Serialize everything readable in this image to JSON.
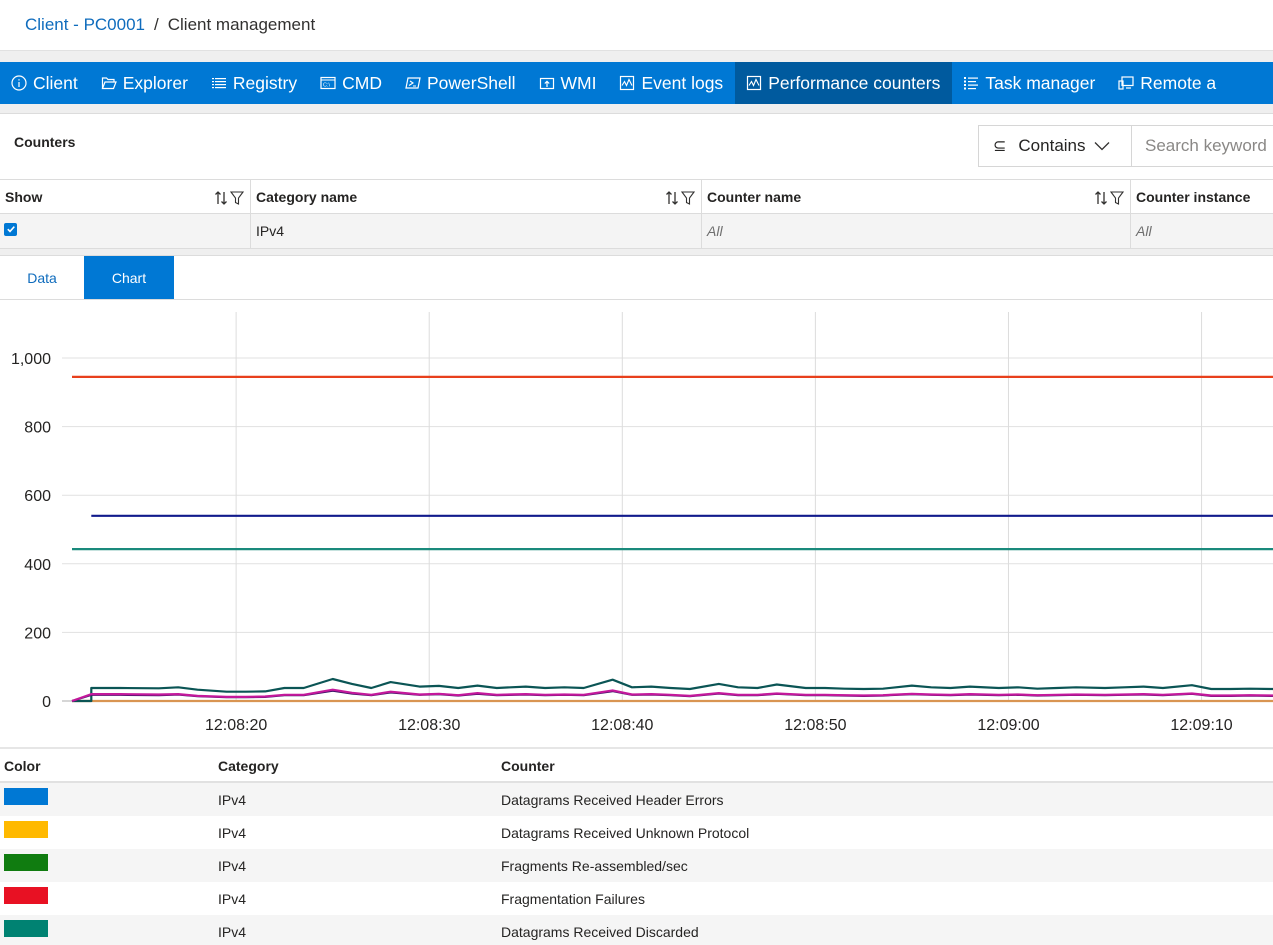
{
  "breadcrumb": {
    "link": "Client - PC0001",
    "separator": "/",
    "current": "Client management"
  },
  "toolbar": {
    "items": [
      {
        "label": "Client",
        "icon": "info-icon",
        "active": false
      },
      {
        "label": "Explorer",
        "icon": "folder-open-icon",
        "active": false
      },
      {
        "label": "Registry",
        "icon": "list-icon",
        "active": false
      },
      {
        "label": "CMD",
        "icon": "terminal-icon",
        "active": false
      },
      {
        "label": "PowerShell",
        "icon": "powershell-icon",
        "active": false
      },
      {
        "label": "WMI",
        "icon": "upload-box-icon",
        "active": false
      },
      {
        "label": "Event logs",
        "icon": "chart-box-icon",
        "active": false
      },
      {
        "label": "Performance counters",
        "icon": "chart-box-icon",
        "active": true
      },
      {
        "label": "Task manager",
        "icon": "task-list-icon",
        "active": false
      },
      {
        "label": "Remote a",
        "icon": "remote-desktop-icon",
        "active": false
      }
    ],
    "colors": {
      "bar": "#0078d4",
      "active": "#005a9e"
    }
  },
  "counters": {
    "title": "Counters",
    "filter_mode": "Contains",
    "search_placeholder": "Search keyword",
    "columns": [
      "Show",
      "Category name",
      "Counter name",
      "Counter instance"
    ],
    "rows": [
      {
        "show": true,
        "category": "IPv4",
        "counter": "All",
        "instance": "All"
      }
    ]
  },
  "view_tabs": {
    "items": [
      "Data",
      "Chart"
    ],
    "active": "Chart"
  },
  "chart_data": {
    "type": "line",
    "title": "",
    "xlabel": "",
    "ylabel": "",
    "ylim": [
      0,
      1100
    ],
    "yticks": [
      0,
      200,
      400,
      600,
      800,
      1000
    ],
    "ytick_labels": [
      "0",
      "200",
      "400",
      "600",
      "800",
      "1,000"
    ],
    "xlim_seconds": [
      11.5,
      73.7
    ],
    "xticks_seconds": [
      20,
      30,
      40,
      50,
      60,
      70
    ],
    "xtick_labels": [
      "12:08:20",
      "12:08:30",
      "12:08:40",
      "12:08:50",
      "12:09:00",
      "12:09:10"
    ],
    "x_base_time": "12:08:00",
    "grid": true,
    "series": [
      {
        "name": "Series (red)",
        "color": "#e8401c",
        "x": [
          11.5,
          73.7
        ],
        "values": [
          945,
          945
        ]
      },
      {
        "name": "Series (navy)",
        "color": "#111a8c",
        "x": [
          12.5,
          73.7
        ],
        "values": [
          540,
          540
        ]
      },
      {
        "name": "Series (teal)",
        "color": "#1a8a7c",
        "x": [
          11.5,
          73.7
        ],
        "values": [
          443,
          443
        ]
      },
      {
        "name": "Series (orange)",
        "color": "#d99552",
        "x": [
          11.5,
          73.7
        ],
        "values": [
          0,
          0
        ]
      },
      {
        "name": "Series (dark teal)",
        "color": "#0b5555",
        "x": [
          11.5,
          12.5,
          12.5,
          14,
          16,
          17,
          18,
          19.5,
          20.5,
          21.5,
          22.5,
          23.5,
          25,
          26,
          27,
          28,
          29.5,
          30.5,
          31.5,
          32.5,
          33.5,
          35,
          36,
          37,
          38,
          39.5,
          40.5,
          41.5,
          42.5,
          43.5,
          45,
          46,
          47,
          48,
          49.5,
          50.5,
          51.5,
          52.5,
          53.5,
          55,
          56,
          57,
          58,
          59.5,
          60.5,
          61.5,
          62.5,
          63.5,
          65,
          66,
          67,
          68,
          69.5,
          70.5,
          71.5,
          72.5,
          73.7
        ],
        "values": [
          0,
          0,
          38,
          38,
          37,
          40,
          33,
          27,
          27,
          28,
          38,
          38,
          64,
          50,
          38,
          55,
          42,
          44,
          38,
          45,
          38,
          42,
          38,
          40,
          38,
          62,
          40,
          42,
          38,
          35,
          50,
          40,
          38,
          48,
          38,
          38,
          36,
          35,
          36,
          45,
          40,
          38,
          42,
          38,
          40,
          36,
          38,
          40,
          38,
          40,
          42,
          38,
          46,
          35,
          35,
          36,
          35
        ]
      },
      {
        "name": "Series (purple)",
        "color": "#3a1366",
        "x": [
          11.5,
          12.5,
          12.5,
          14,
          16,
          17,
          18,
          19.5,
          20.5,
          21.5,
          22.5,
          23.5,
          25,
          26,
          27,
          28,
          29.5,
          30.5,
          31.5,
          32.5,
          33.5,
          35,
          36,
          37,
          38,
          39.5,
          40.5,
          41.5,
          42.5,
          43.5,
          45,
          46,
          47,
          48,
          49.5,
          50.5,
          51.5,
          52.5,
          53.5,
          55,
          56,
          57,
          58,
          59.5,
          60.5,
          61.5,
          62.5,
          63.5,
          65,
          66,
          67,
          68,
          69.5,
          70.5,
          71.5,
          72.5,
          73.7
        ],
        "values": [
          0,
          18,
          18,
          18,
          17,
          19,
          14,
          11,
          11,
          12,
          17,
          17,
          30,
          22,
          17,
          25,
          18,
          20,
          16,
          21,
          17,
          19,
          17,
          18,
          17,
          29,
          18,
          19,
          17,
          14,
          22,
          17,
          17,
          21,
          17,
          17,
          16,
          15,
          16,
          20,
          18,
          17,
          19,
          17,
          18,
          16,
          17,
          18,
          17,
          18,
          19,
          17,
          21,
          15,
          15,
          16,
          15
        ]
      },
      {
        "name": "Series (magenta)",
        "color": "#c4189b",
        "x": [
          11.5,
          12.5,
          14,
          16,
          17,
          18,
          19.5,
          20.5,
          21.5,
          22.5,
          23.5,
          25,
          26,
          27,
          28,
          29.5,
          30.5,
          31.5,
          32.5,
          33.5,
          35,
          36,
          37,
          38,
          39.5,
          40.5,
          41.5,
          42.5,
          43.5,
          45,
          46,
          47,
          48,
          49.5,
          50.5,
          51.5,
          52.5,
          53.5,
          55,
          56,
          57,
          58,
          59.5,
          60.5,
          61.5,
          62.5,
          63.5,
          65,
          66,
          67,
          68,
          69.5,
          70.5,
          71.5,
          72.5,
          73.7
        ],
        "values": [
          0,
          20,
          20,
          19,
          20,
          15,
          12,
          12,
          13,
          18,
          18,
          33,
          24,
          18,
          27,
          19,
          21,
          17,
          23,
          18,
          20,
          18,
          19,
          18,
          31,
          19,
          20,
          18,
          15,
          23,
          18,
          18,
          22,
          18,
          18,
          17,
          16,
          17,
          21,
          19,
          18,
          20,
          18,
          19,
          17,
          18,
          19,
          18,
          19,
          20,
          18,
          22,
          16,
          16,
          17,
          16
        ]
      }
    ]
  },
  "legend": {
    "columns": [
      "Color",
      "Category",
      "Counter"
    ],
    "rows": [
      {
        "color": "#0078d4",
        "category": "IPv4",
        "counter": "Datagrams Received Header Errors"
      },
      {
        "color": "#ffb900",
        "category": "IPv4",
        "counter": "Datagrams Received Unknown Protocol"
      },
      {
        "color": "#107c10",
        "category": "IPv4",
        "counter": "Fragments Re-assembled/sec"
      },
      {
        "color": "#e81123",
        "category": "IPv4",
        "counter": "Fragmentation Failures"
      },
      {
        "color": "#008272",
        "category": "IPv4",
        "counter": "Datagrams Received Discarded"
      }
    ]
  }
}
